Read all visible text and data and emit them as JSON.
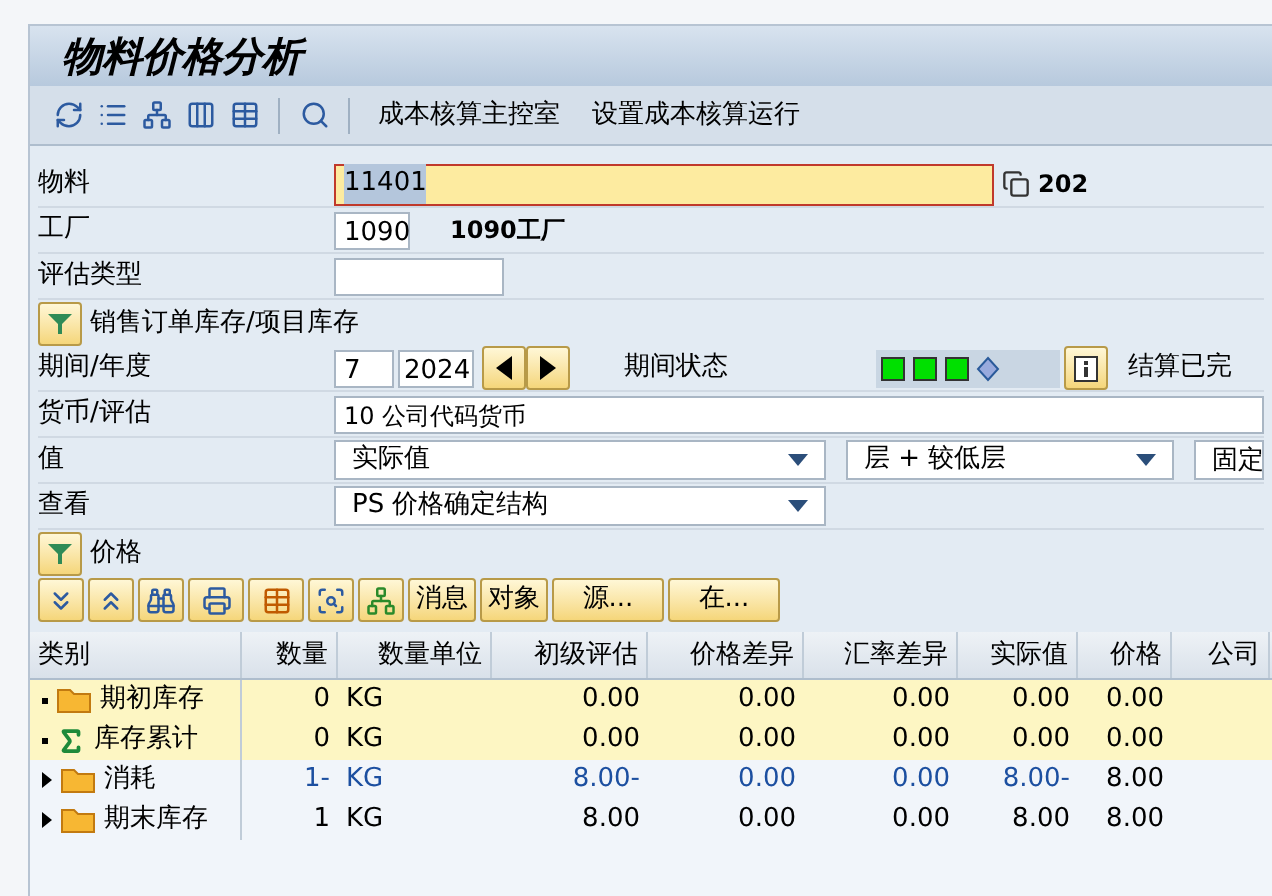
{
  "window": {
    "title": "物料价格分析"
  },
  "toolbar": {
    "links": [
      "成本核算主控室",
      "设置成本核算运行"
    ]
  },
  "form": {
    "material": {
      "label": "物料",
      "value": "11401",
      "suffix": "202"
    },
    "plant": {
      "label": "工厂",
      "value": "1090",
      "description": "1090工厂"
    },
    "valuation_type": {
      "label": "评估类型"
    },
    "sales_order_stock": {
      "label": "销售订单库存/项目库存"
    },
    "period": {
      "label": "期间/年度",
      "period": "7",
      "year": "2024",
      "status_label": "期间状态",
      "status_text": "结算已完"
    },
    "currency": {
      "label": "货币/评估",
      "value": "10 公司代码货币"
    },
    "value": {
      "label": "值",
      "value": "实际值",
      "level": "层 + 较低层",
      "extra": "固定"
    },
    "view": {
      "label": "查看",
      "value": "PS 价格确定结构"
    },
    "price": {
      "label": "价格"
    }
  },
  "table_toolbar": {
    "buttons": [
      "消息",
      "对象",
      "源...",
      "在..."
    ]
  },
  "table": {
    "columns": [
      "类别",
      "数量",
      "数量单位",
      "初级评估",
      "价格差异",
      "汇率差异",
      "实际值",
      "价格",
      "公司"
    ],
    "rows": [
      {
        "kind": "folder",
        "expandable": false,
        "highlighted": true,
        "color": "#000000",
        "cells": [
          "期初库存",
          "0",
          "KG",
          "0.00",
          "0.00",
          "0.00",
          "0.00",
          "0.00"
        ]
      },
      {
        "kind": "sum",
        "expandable": false,
        "highlighted": true,
        "color": "#000000",
        "cells": [
          "库存累计",
          "0",
          "KG",
          "0.00",
          "0.00",
          "0.00",
          "0.00",
          "0.00"
        ]
      },
      {
        "kind": "folder",
        "expandable": true,
        "highlighted": false,
        "color": "#1c4fa0",
        "cells": [
          "消耗",
          "1-",
          "KG",
          "8.00-",
          "0.00",
          "0.00",
          "8.00-",
          "8.00"
        ]
      },
      {
        "kind": "folder",
        "expandable": true,
        "highlighted": false,
        "color": "#000000",
        "cells": [
          "期末库存",
          "1",
          "KG",
          "8.00",
          "0.00",
          "0.00",
          "8.00",
          "8.00"
        ]
      }
    ]
  }
}
